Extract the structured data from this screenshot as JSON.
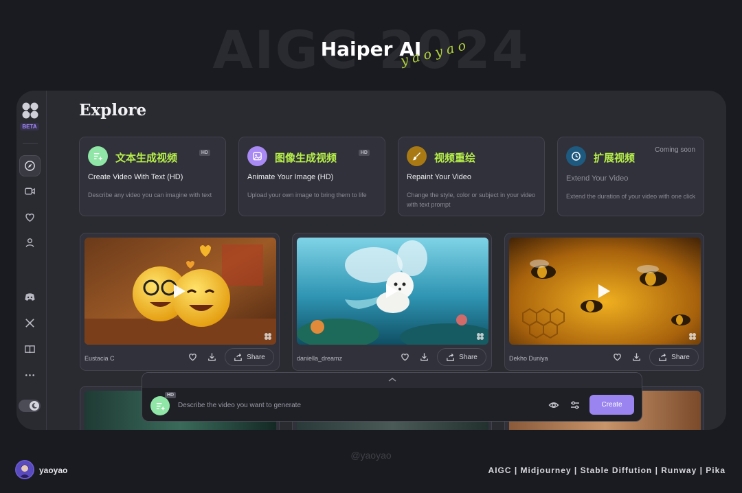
{
  "poster": {
    "bg_title": "AIGC 2024",
    "title": "Haiper AI",
    "signature": "yaoyao",
    "footer_handle": "@yaoyao",
    "author_name": "yaoyao",
    "tags": "AIGC | Midjourney | Stable Diffution | Runway | Pika"
  },
  "sidebar": {
    "beta_label": "BETA",
    "items": [
      {
        "name": "explore",
        "icon": "compass-icon",
        "active": true
      },
      {
        "name": "videos",
        "icon": "video-camera-icon"
      },
      {
        "name": "favorites",
        "icon": "heart-icon"
      },
      {
        "name": "profile",
        "icon": "user-icon"
      },
      {
        "name": "discord",
        "icon": "discord-icon"
      },
      {
        "name": "x",
        "icon": "x-logo-icon"
      },
      {
        "name": "docs",
        "icon": "book-icon"
      },
      {
        "name": "more",
        "icon": "more-icon"
      }
    ],
    "theme": "dark"
  },
  "main": {
    "title": "Explore",
    "features": [
      {
        "cn": "文本生成视频",
        "en": "Create Video With Text (HD)",
        "desc": "Describe any video you can imagine with text",
        "badge": "HD",
        "color": "#8fe6a6"
      },
      {
        "cn": "图像生成视频",
        "en": "Animate Your Image (HD)",
        "desc": "Upload your own image to bring them to life",
        "badge": "HD",
        "color": "#a98af5"
      },
      {
        "cn": "视频重绘",
        "en": "Repaint Your Video",
        "desc": "Change the style, color or subject in your video with text prompt",
        "badge": "",
        "color": "#a97a14"
      },
      {
        "cn": "扩展视频",
        "en": "Extend Your Video",
        "desc": "Extend the duration of your video with one click",
        "badge": "Coming soon",
        "color": "#1e5a80"
      }
    ],
    "videos": [
      {
        "author": "Eustacia C",
        "share": "Share"
      },
      {
        "author": "daniella_dreamz",
        "share": "Share"
      },
      {
        "author": "Dekho Duniya",
        "share": "Share"
      }
    ]
  },
  "prompt": {
    "badge": "HD",
    "placeholder": "Describe the video you want to generate",
    "create_label": "Create"
  },
  "colors": {
    "accent": "#9a84f0",
    "highlight_text": "#b7f04a",
    "background": "#1a1b20",
    "panel": "#2a2b31"
  }
}
